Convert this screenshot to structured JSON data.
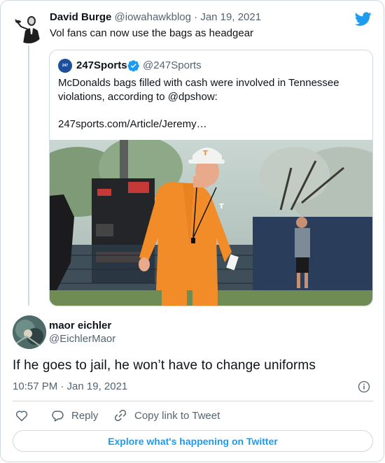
{
  "parent_tweet": {
    "name": "David Burge",
    "handle": "@iowahawkblog",
    "separator": " · ",
    "date": "Jan 19, 2021",
    "text": "Vol fans can now use the bags as headgear"
  },
  "quoted_tweet": {
    "avatar_text": "247",
    "name": "247Sports",
    "handle": "@247Sports",
    "text": "McDonalds bags filled with cash were involved in Tennessee violations, according to @dpshow:",
    "link": "247sports.com/Article/Jeremy…"
  },
  "reply_tweet": {
    "name": "maor eichler",
    "handle": "@EichlerMaor",
    "text": "If he goes to jail, he won’t have to change uniforms",
    "time": "10:57 PM · Jan 19, 2021"
  },
  "actions": {
    "reply_label": "Reply",
    "copy_link_label": "Copy link to Tweet"
  },
  "footer": {
    "explore_label": "Explore what's happening on Twitter"
  },
  "colors": {
    "twitter_blue": "#1d9bf0",
    "secondary_text": "#536471",
    "border": "#cfd9de",
    "tennessee_orange": "#f28c28"
  },
  "icons": [
    "twitter-logo-icon",
    "verified-badge-icon",
    "info-icon",
    "heart-icon",
    "reply-icon",
    "link-icon"
  ]
}
